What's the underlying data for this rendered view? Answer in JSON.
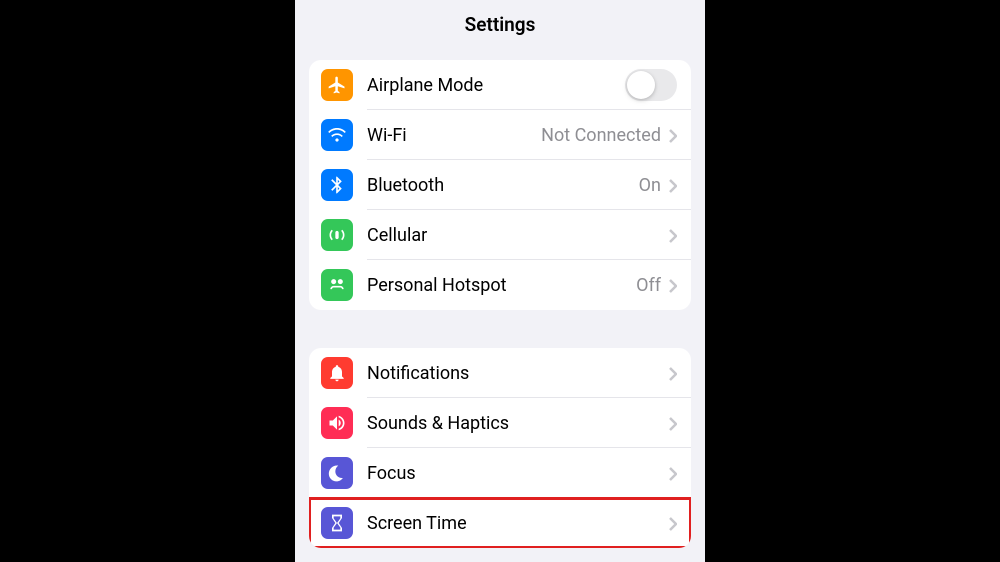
{
  "header": {
    "title": "Settings"
  },
  "groups": [
    {
      "rows": [
        {
          "id": "airplane",
          "label": "Airplane Mode",
          "control": "toggle",
          "toggle_on": false,
          "icon_bg": "bg-orange"
        },
        {
          "id": "wifi",
          "label": "Wi-Fi",
          "control": "nav",
          "value": "Not Connected",
          "icon_bg": "bg-blue"
        },
        {
          "id": "bluetooth",
          "label": "Bluetooth",
          "control": "nav",
          "value": "On",
          "icon_bg": "bg-blue"
        },
        {
          "id": "cellular",
          "label": "Cellular",
          "control": "nav",
          "value": "",
          "icon_bg": "bg-green"
        },
        {
          "id": "hotspot",
          "label": "Personal Hotspot",
          "control": "nav",
          "value": "Off",
          "icon_bg": "bg-green"
        }
      ]
    },
    {
      "rows": [
        {
          "id": "notifications",
          "label": "Notifications",
          "control": "nav",
          "value": "",
          "icon_bg": "bg-red"
        },
        {
          "id": "sounds",
          "label": "Sounds & Haptics",
          "control": "nav",
          "value": "",
          "icon_bg": "bg-pinkred"
        },
        {
          "id": "focus",
          "label": "Focus",
          "control": "nav",
          "value": "",
          "icon_bg": "bg-indigo"
        },
        {
          "id": "screentime",
          "label": "Screen Time",
          "control": "nav",
          "value": "",
          "icon_bg": "bg-indigo",
          "highlighted": true
        }
      ]
    }
  ]
}
